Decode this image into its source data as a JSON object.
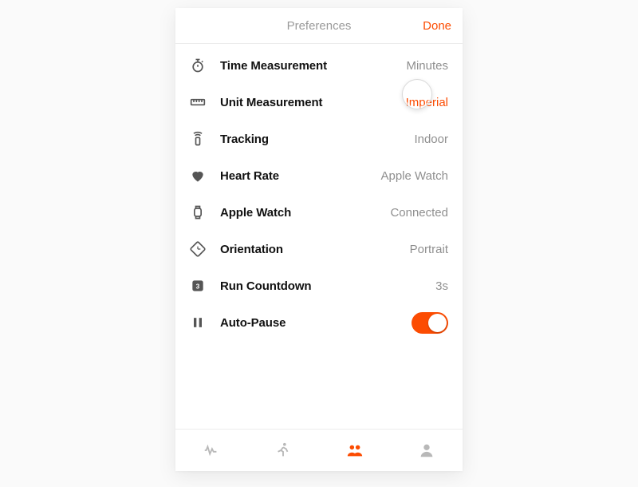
{
  "header": {
    "title": "Preferences",
    "done": "Done"
  },
  "rows": {
    "time": {
      "label": "Time Measurement",
      "value": "Minutes"
    },
    "unit": {
      "label": "Unit Measurement",
      "value": "Imperial"
    },
    "tracking": {
      "label": "Tracking",
      "value": "Indoor"
    },
    "heartrate": {
      "label": "Heart Rate",
      "value": "Apple Watch"
    },
    "watch": {
      "label": "Apple Watch",
      "value": "Connected"
    },
    "orientation": {
      "label": "Orientation",
      "value": "Portrait"
    },
    "countdown": {
      "label": "Run Countdown",
      "value": "3s"
    },
    "autopause": {
      "label": "Auto-Pause",
      "on": true
    }
  },
  "tabbar": {
    "items": [
      "activity",
      "runner",
      "friends",
      "profile"
    ],
    "active": "friends"
  },
  "highlight": {
    "target_row": "unit"
  }
}
